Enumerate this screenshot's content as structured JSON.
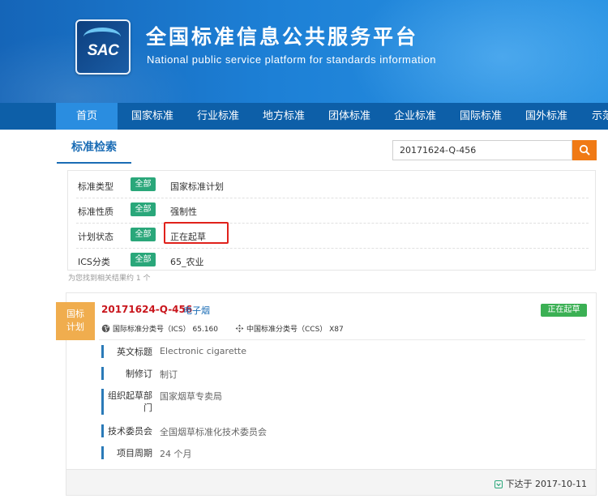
{
  "header": {
    "logo_text": "SAC",
    "title": "全国标准信息公共服务平台",
    "subtitle": "National public service platform  for standards information"
  },
  "nav": [
    "首页",
    "国家标准",
    "行业标准",
    "地方标准",
    "团体标准",
    "企业标准",
    "国际标准",
    "国外标准",
    "示范"
  ],
  "nav_active": "首页",
  "search": {
    "tab": "标准检索",
    "value": "20171624-Q-456"
  },
  "filters": [
    {
      "label": "标准类型",
      "all": "全部",
      "value": "国家标准计划"
    },
    {
      "label": "标准性质",
      "all": "全部",
      "value": "强制性"
    },
    {
      "label": "计划状态",
      "all": "全部",
      "value": "正在起草"
    },
    {
      "label": "ICS分类",
      "all": "全部",
      "value": "65_农业"
    }
  ],
  "result_count": "为您找到相关结果约 1 个",
  "result": {
    "badge_line1": "国标",
    "badge_line2": "计划",
    "code": "20171624-Q-456",
    "name": "电子烟",
    "status": "正在起草",
    "ics": "国际标准分类号（ICS）  65.160",
    "ccs": "中国标准分类号（CCS）  X87",
    "details": [
      {
        "label": "英文标题",
        "value": "Electronic cigarette"
      },
      {
        "label": "制修订",
        "value": "制订"
      },
      {
        "label": "组织起草部门",
        "value": "国家烟草专卖局"
      },
      {
        "label": "技术委员会",
        "value": "全国烟草标准化技术委员会"
      },
      {
        "label": "项目周期",
        "value": "24 个月"
      }
    ],
    "issued": "下达于 2017-10-11"
  },
  "colors": {
    "nav_bg": "#0d5fa8",
    "accent_blue": "#1a6cb5",
    "tag_green": "#2aa77a",
    "status_green": "#3bb054",
    "badge_orange": "#f0ad4e",
    "search_orange": "#f07a15",
    "highlight_red": "#e0211b"
  }
}
